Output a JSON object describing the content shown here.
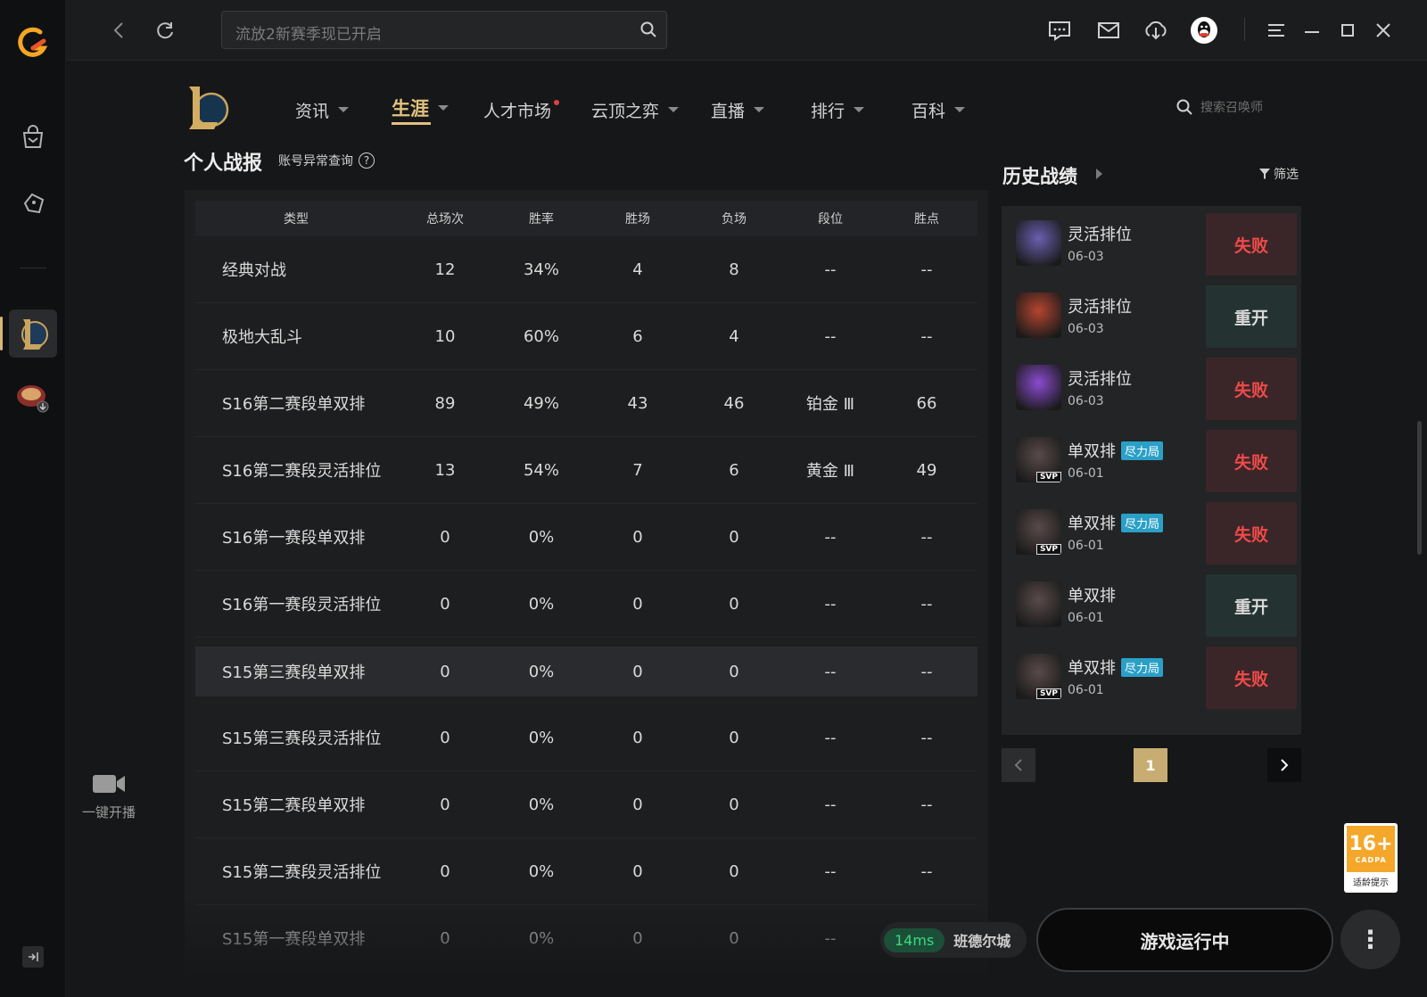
{
  "top": {
    "search_placeholder": "流放2新赛季现已开启"
  },
  "lol_nav": {
    "items": [
      {
        "label": "资讯"
      },
      {
        "label": "生涯"
      },
      {
        "label": "人才市场"
      },
      {
        "label": "云顶之弈"
      },
      {
        "label": "直播"
      },
      {
        "label": "排行"
      },
      {
        "label": "百科"
      }
    ],
    "summoner_search_placeholder": "搜索召唤师"
  },
  "personal": {
    "title": "个人战报",
    "account_check": "账号异常查询",
    "help": "?"
  },
  "stats_table": {
    "headers": [
      "类型",
      "总场次",
      "胜率",
      "胜场",
      "负场",
      "段位",
      "胜点"
    ],
    "rows": [
      [
        "经典对战",
        "12",
        "34%",
        "4",
        "8",
        "--",
        "--"
      ],
      [
        "极地大乱斗",
        "10",
        "60%",
        "6",
        "4",
        "--",
        "--"
      ],
      [
        "S16第二赛段单双排",
        "89",
        "49%",
        "43",
        "46",
        "铂金 Ⅲ",
        "66"
      ],
      [
        "S16第二赛段灵活排位",
        "13",
        "54%",
        "7",
        "6",
        "黄金 Ⅲ",
        "49"
      ],
      [
        "S16第一赛段单双排",
        "0",
        "0%",
        "0",
        "0",
        "--",
        "--"
      ],
      [
        "S16第一赛段灵活排位",
        "0",
        "0%",
        "0",
        "0",
        "--",
        "--"
      ],
      [
        "S15第三赛段单双排",
        "0",
        "0%",
        "0",
        "0",
        "--",
        "--"
      ],
      [
        "S15第三赛段灵活排位",
        "0",
        "0%",
        "0",
        "0",
        "--",
        "--"
      ],
      [
        "S15第二赛段单双排",
        "0",
        "0%",
        "0",
        "0",
        "--",
        "--"
      ],
      [
        "S15第二赛段灵活排位",
        "0",
        "0%",
        "0",
        "0",
        "--",
        "--"
      ],
      [
        "S15第一赛段单双排",
        "0",
        "0%",
        "0",
        "0",
        "--",
        "--"
      ]
    ]
  },
  "history": {
    "title": "历史战绩",
    "filter": "筛选",
    "matches": [
      {
        "mode": "灵活排位",
        "date": "06-03",
        "badge": "",
        "result": "失败",
        "color": "#6a5fb0"
      },
      {
        "mode": "灵活排位",
        "date": "06-03",
        "badge": "",
        "result": "重开",
        "color": "#b5452f"
      },
      {
        "mode": "灵活排位",
        "date": "06-03",
        "badge": "",
        "result": "失败",
        "color": "#8a4bd0"
      },
      {
        "mode": "单双排",
        "date": "06-01",
        "badge": "尽力局",
        "result": "失败",
        "color": "#5a4a4a"
      },
      {
        "mode": "单双排",
        "date": "06-01",
        "badge": "尽力局",
        "result": "失败",
        "color": "#5a4a4a"
      },
      {
        "mode": "单双排",
        "date": "06-01",
        "badge": "",
        "result": "重开",
        "color": "#5a4a4a"
      },
      {
        "mode": "单双排",
        "date": "06-01",
        "badge": "尽力局",
        "result": "失败",
        "color": "#5a4a4a"
      }
    ],
    "svp_label": "SVP",
    "page": "1"
  },
  "stream": {
    "label": "一键开播"
  },
  "status": {
    "ping": "14ms",
    "region": "班德尔城",
    "run_button": "游戏运行中"
  },
  "age_badge": {
    "age": "16+",
    "org": "CADPA",
    "text": "适龄提示"
  }
}
